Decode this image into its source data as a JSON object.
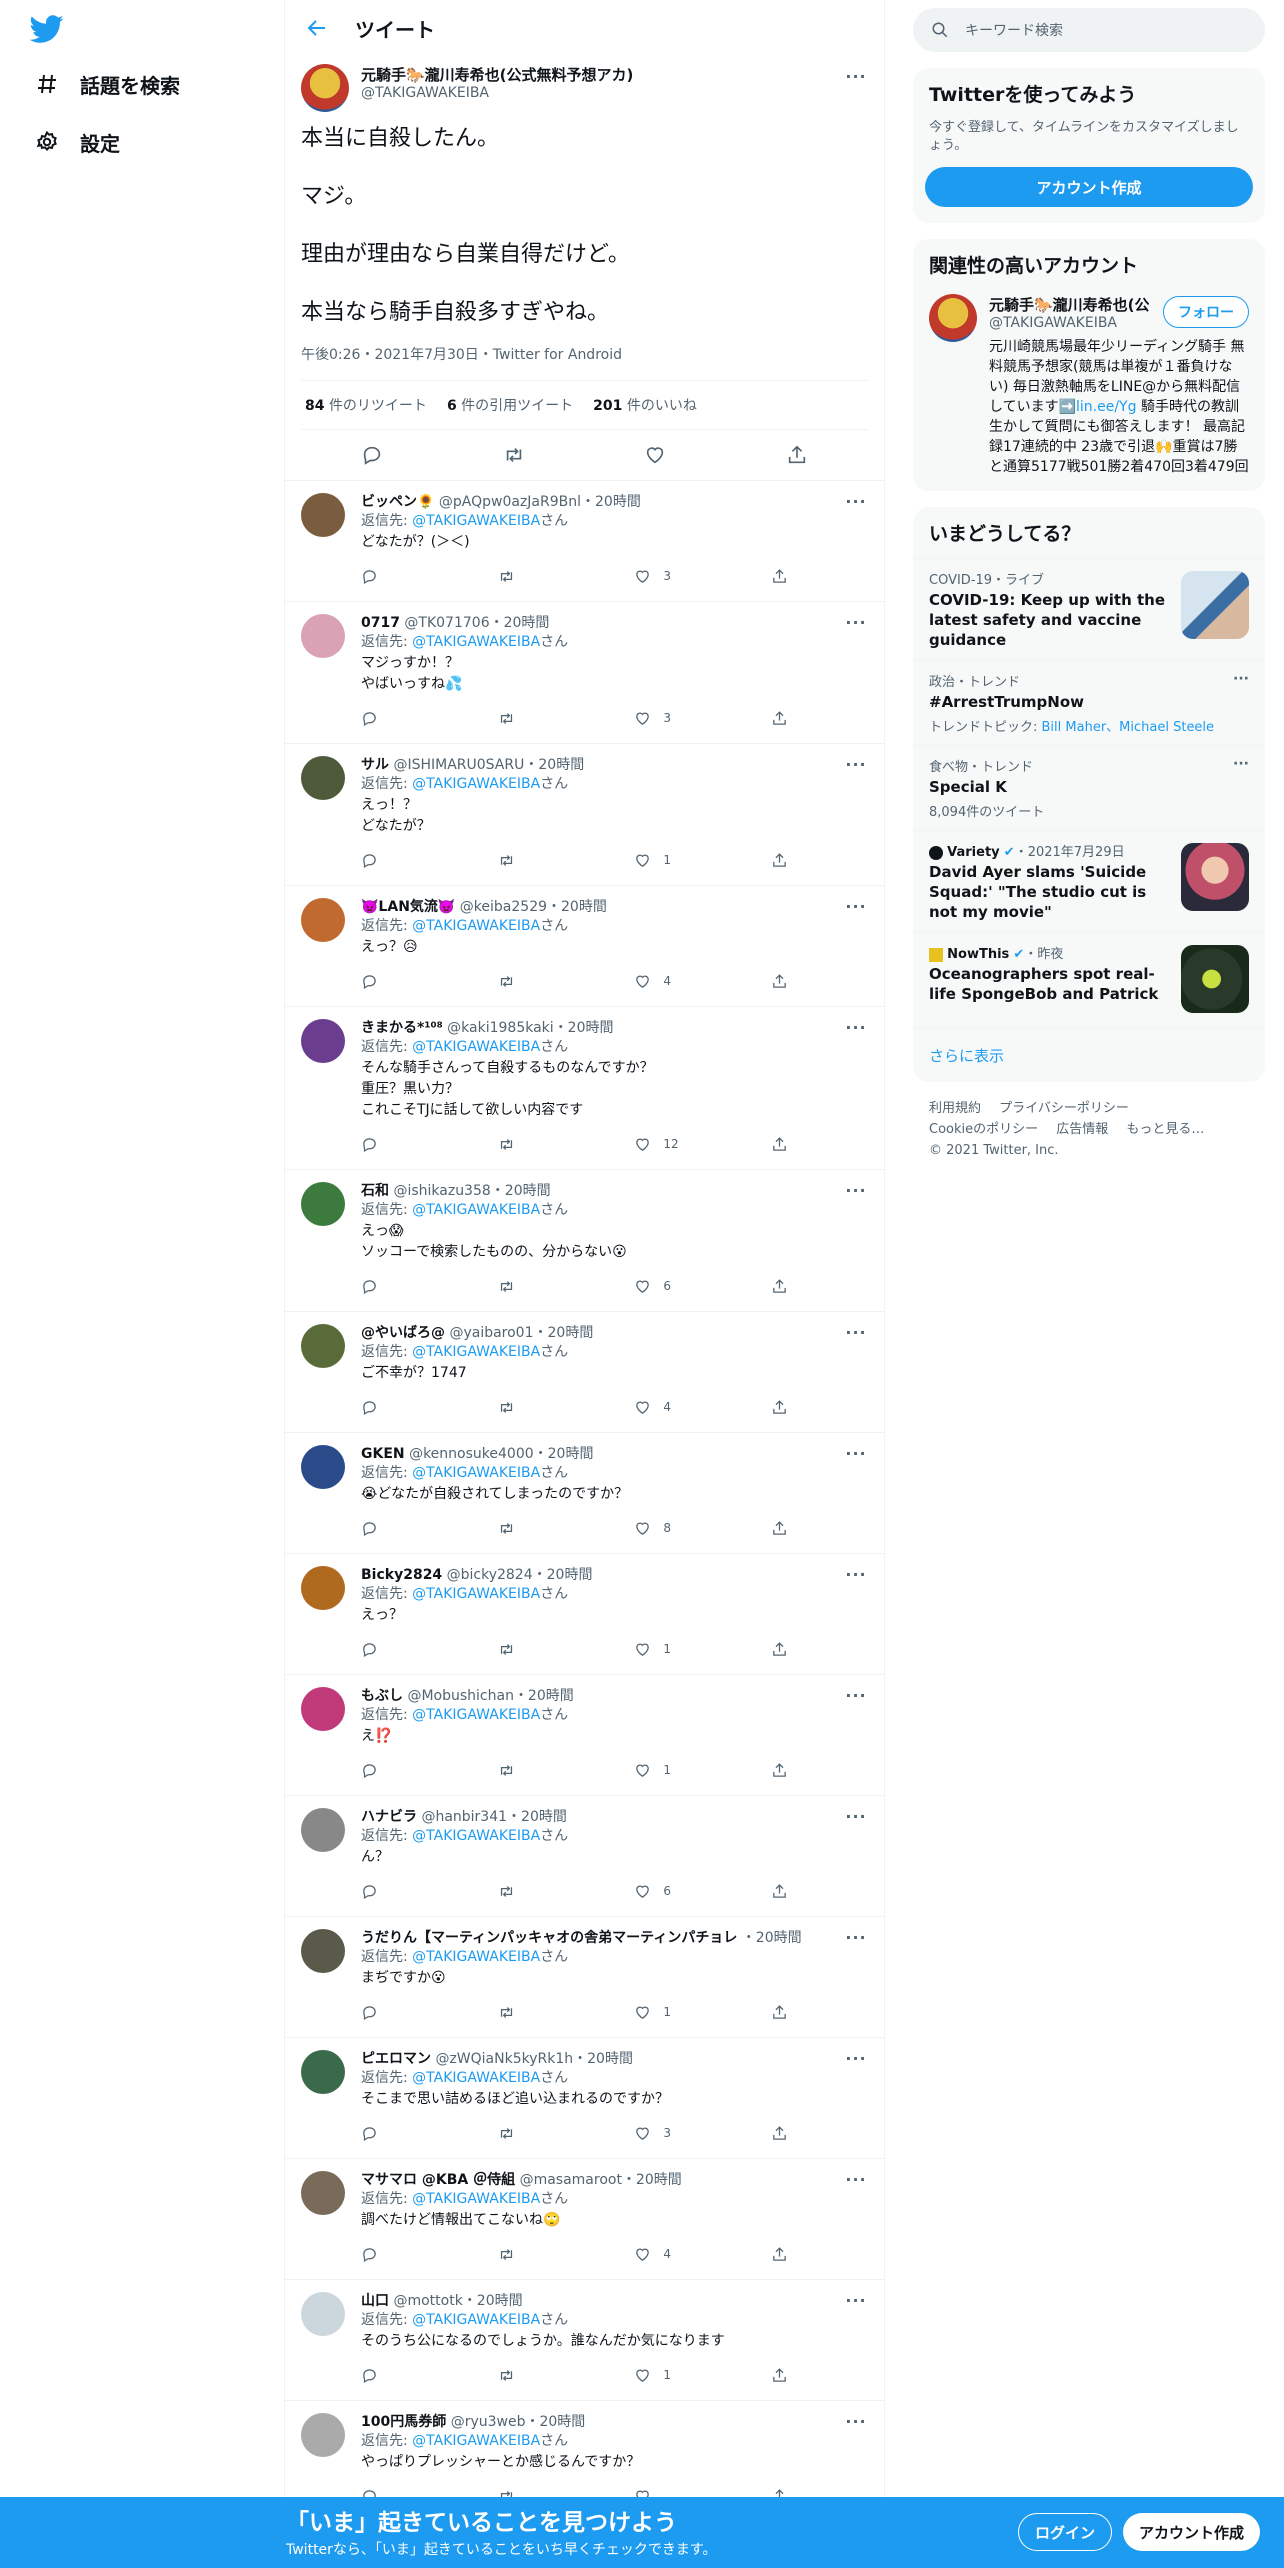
{
  "nav": {
    "explore_label": "話題を検索",
    "settings_label": "設定"
  },
  "header": {
    "title": "ツイート"
  },
  "focal": {
    "name": "元騎手🐎瀧川寿希也(公式無料予想アカ)",
    "handle": "@TAKIGAWAKEIBA",
    "lines": [
      "本当に自殺したん。",
      "マジ。",
      "理由が理由なら自業自得だけど。",
      "本当なら騎手自殺多すぎやね。"
    ],
    "meta": "午後0:26・2021年7月30日・Twitter for Android",
    "retweets_count": "84",
    "retweets_label": "件のリツイート",
    "quotes_count": "6",
    "quotes_label": "件の引用ツイート",
    "likes_count": "201",
    "likes_label": "件のいいね"
  },
  "reply_prefix": "返信先:",
  "reply_mention": "@TAKIGAWAKEIBA",
  "reply_suffix": "さん",
  "replies": [
    {
      "name": "ビッペン🌻",
      "handle": "@pAQpw0azJaR9Bnl",
      "time": "・20時間",
      "text": "どなたが？(＞＜)",
      "likes": "3",
      "color": "#7a5c3e"
    },
    {
      "name": "0717",
      "handle": "@TK071706",
      "time": "・20時間",
      "text": "マジっすか！？\nやばいっすね💦",
      "likes": "3",
      "color": "#d9a3b5"
    },
    {
      "name": "サル",
      "handle": "@ISHIMARU0SARU",
      "time": "・20時間",
      "text": "えっ！？\nどなたが？",
      "likes": "1",
      "color": "#4e5a3a"
    },
    {
      "name": "👿LAN気流👿",
      "handle": "@keiba2529",
      "time": "・20時間",
      "text": "えっ？😥",
      "likes": "4",
      "color": "#c06a30"
    },
    {
      "name": "きまかる*¹⁰⁸",
      "handle": "@kaki1985kaki",
      "time": "・20時間",
      "text": "そんな騎手さんって自殺するものなんですか？\n重圧？黒い力？\nこれこそTJに話して欲しい内容です",
      "likes": "12",
      "color": "#6b3d8f"
    },
    {
      "name": "石和",
      "handle": "@ishikazu358",
      "time": "・20時間",
      "text": "えっ😱\nソッコーで検索したものの、分からない😮",
      "likes": "6",
      "color": "#3d7a3d"
    },
    {
      "name": "@やいばろ@",
      "handle": "@yaibaro01",
      "time": "・20時間",
      "text": "ご不幸が？1747",
      "likes": "4",
      "color": "#5a6b3a"
    },
    {
      "name": "GKEN",
      "handle": "@kennosuke4000",
      "time": "・20時間",
      "text": "😭どなたが自殺されてしまったのですか？",
      "likes": "8",
      "color": "#2a4a8a"
    },
    {
      "name": "Bicky2824",
      "handle": "@bicky2824",
      "time": "・20時間",
      "text": "えっ？",
      "likes": "1",
      "color": "#b06a20"
    },
    {
      "name": "もぶし",
      "handle": "@Mobushichan",
      "time": "・20時間",
      "text": "え⁉️",
      "likes": "1",
      "color": "#c03a7a"
    },
    {
      "name": "ハナビラ",
      "handle": "@hanbir341",
      "time": "・20時間",
      "text": "ん？",
      "likes": "6",
      "color": "#888888"
    },
    {
      "name": "うだりん【マーティンパッキャオの舎弟マーティンパチョレ",
      "handle": "",
      "time": "・20時間",
      "text": "まぢですか😮",
      "likes": "1",
      "color": "#5a5a4a"
    },
    {
      "name": "ピエロマン",
      "handle": "@zWQiaNk5kyRk1h",
      "time": "・20時間",
      "text": "そこまで思い詰めるほど追い込まれるのですか？",
      "likes": "3",
      "color": "#3a6a4a"
    },
    {
      "name": "マサマロ @KBA ＠侍組",
      "handle": "@masamaroot",
      "time": "・20時間",
      "text": "調べたけど情報出てこないね🙄",
      "likes": "4",
      "color": "#7a6a5a"
    },
    {
      "name": "山口",
      "handle": "@mottotk",
      "time": "・20時間",
      "text": "そのうち公になるのでしょうか。誰なんだか気になります",
      "likes": "1",
      "color": "#ccd6dd"
    },
    {
      "name": "100円馬券師",
      "handle": "@ryu3web",
      "time": "・20時間",
      "text": "やっぱりプレッシャーとか感じるんですか？",
      "likes": "",
      "color": "#aaaaaa"
    }
  ],
  "search": {
    "placeholder": "キーワード検索"
  },
  "signup_panel": {
    "title": "Twitterを使ってみよう",
    "subtitle": "今すぐ登録して、タイムラインをカスタマイズしましょう。",
    "button": "アカウント作成"
  },
  "related": {
    "title": "関連性の高いアカウント",
    "name": "元騎手🐎瀧川寿希也(公",
    "handle": "@TAKIGAWAKEIBA",
    "follow": "フォロー",
    "bio_1": "元川崎競馬場最年少リーディング騎手 無料競馬予想家(競馬は単複が１番負けない) 毎日激熱軸馬をLINE@から無料配信しています➡️",
    "bio_link": "lin.ee/Yg",
    "bio_2": " 騎手時代の教訓生かして質問にも御答えします！ 最高記録17連続的中 23歳で引退🙌重賞は7勝と通算5177戦501勝2着470回3着479回"
  },
  "trends": {
    "title": "いまどうしてる？",
    "items": [
      {
        "meta": "COVID-19・ライブ",
        "name": "COVID-19: Keep up with the latest safety and vaccine guidance",
        "sub": "",
        "color": "#9bbcd6"
      },
      {
        "meta": "政治・トレンド",
        "name": "#ArrestTrumpNow",
        "sub_prefix": "トレンドトピック: ",
        "sub_links": "Bill Maher、Michael Steele"
      },
      {
        "meta": "食べ物・トレンド",
        "name": "Special K",
        "sub": "8,094件のツイート"
      },
      {
        "meta_source": "Variety",
        "meta_time": "・2021年7月29日",
        "name": "David Ayer slams 'Suicide Squad:' \"The studio cut is not my movie\"",
        "color": "#c0506a"
      },
      {
        "meta_source": "NowThis",
        "meta_time": "・昨夜",
        "name": "Oceanographers spot real-life SpongeBob and Patrick",
        "color": "#3a5a3a"
      }
    ],
    "show_more": "さらに表示"
  },
  "footer": {
    "links": [
      "利用規約",
      "プライバシーポリシー",
      "Cookieのポリシー",
      "広告情報",
      "もっと見る…"
    ],
    "copyright": "© 2021 Twitter, Inc."
  },
  "bottom": {
    "title": "「いま」起きていることを見つけよう",
    "subtitle": "Twitterなら、「いま」起きていることをいち早くチェックできます。",
    "login": "ログイン",
    "signup": "アカウント作成"
  },
  "colors": {
    "accent": "#1d9bf0",
    "text": "#0f1419",
    "muted": "#536471"
  }
}
